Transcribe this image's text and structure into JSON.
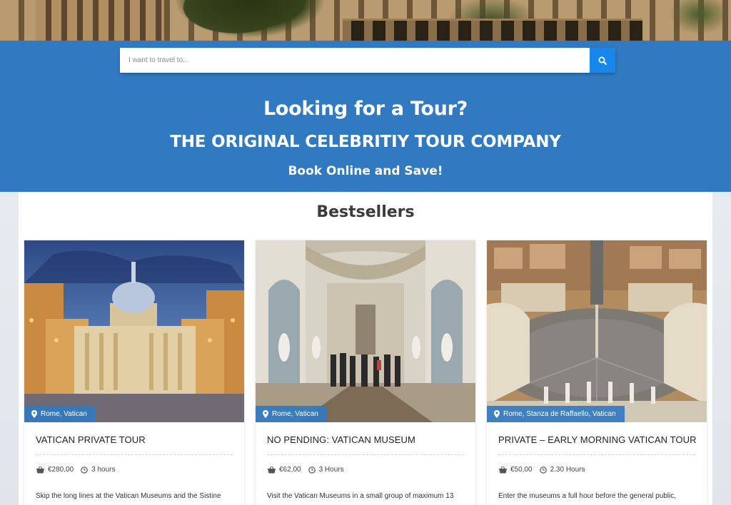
{
  "search": {
    "placeholder": "I want to travel to..."
  },
  "hero": {
    "title": "Looking for a Tour?",
    "subtitle": "THE ORIGINAL CELEBRITIY TOUR COMPANY",
    "tagline": "Book Online and Save!"
  },
  "bestsellers": {
    "title": "Bestsellers",
    "cards": [
      {
        "location": "Rome, Vatican",
        "title": "VATICAN PRIVATE TOUR",
        "price": "€280,00",
        "duration": "3 hours",
        "description": "Skip the long lines at the Vatican Museums and the Sistine"
      },
      {
        "location": "Rome, Vatican",
        "title": "NO PENDING: VATICAN MUSEUM",
        "price": "€62,00",
        "duration": "3 Hours",
        "description": "Visit the Vatican Museums in a small group of maximum 13"
      },
      {
        "location": "Rome, Stanza de Raffaello, Vatican",
        "title": "PRIVATE – EARLY MORNING VATICAN TOUR",
        "price": "€50,00",
        "duration": "2.30 Hours",
        "description": "Enter the museums a full hour before the general public,"
      }
    ]
  },
  "colors": {
    "primary": "#317ac1",
    "search_button": "#1787e9",
    "badge": "#317ac1"
  },
  "icons": {
    "search": "search-icon",
    "location": "map-marker-icon",
    "price": "basket-icon",
    "duration": "clock-icon"
  }
}
